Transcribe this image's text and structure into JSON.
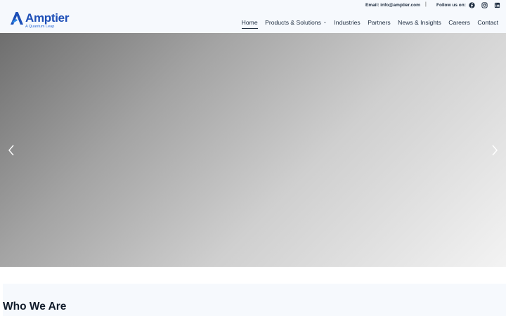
{
  "topbar": {
    "email_text": "Email: info@amptier.com",
    "separator": "|",
    "follow_label": "Follow us on:",
    "social_icons": [
      "facebook-icon",
      "instagram-icon",
      "linkedin-icon"
    ]
  },
  "logo": {
    "name": "Amptier",
    "tagline": "A Quantum Leap",
    "brand_color": "#1d4fb7"
  },
  "nav": {
    "items": [
      {
        "label": "Home",
        "active": true
      },
      {
        "label": "Products & Solutions",
        "dropdown": true
      },
      {
        "label": "Industries"
      },
      {
        "label": "Partners"
      },
      {
        "label": "News & Insights"
      },
      {
        "label": "Careers"
      },
      {
        "label": "Contact"
      }
    ],
    "dropdown_glyph": "⌄"
  },
  "hero": {
    "prev_icon": "chevron-left-icon",
    "next_icon": "chevron-right-icon"
  },
  "section": {
    "title": "Who We Are"
  }
}
